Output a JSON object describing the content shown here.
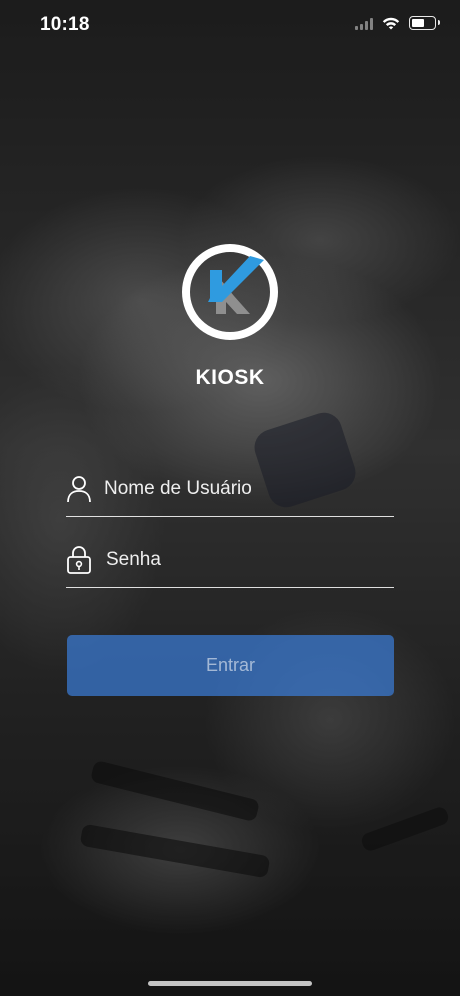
{
  "status_bar": {
    "time": "10:18"
  },
  "app": {
    "name": "KIOSK",
    "logo_icon": "kiosk-logo",
    "accent_color": "#2f9be0"
  },
  "form": {
    "username": {
      "placeholder": "Nome de Usuário",
      "value": "",
      "icon": "user-icon"
    },
    "password": {
      "placeholder": "Senha",
      "value": "",
      "icon": "lock-icon"
    },
    "submit_label": "Entrar",
    "submit_color": "#3a7cd6"
  }
}
